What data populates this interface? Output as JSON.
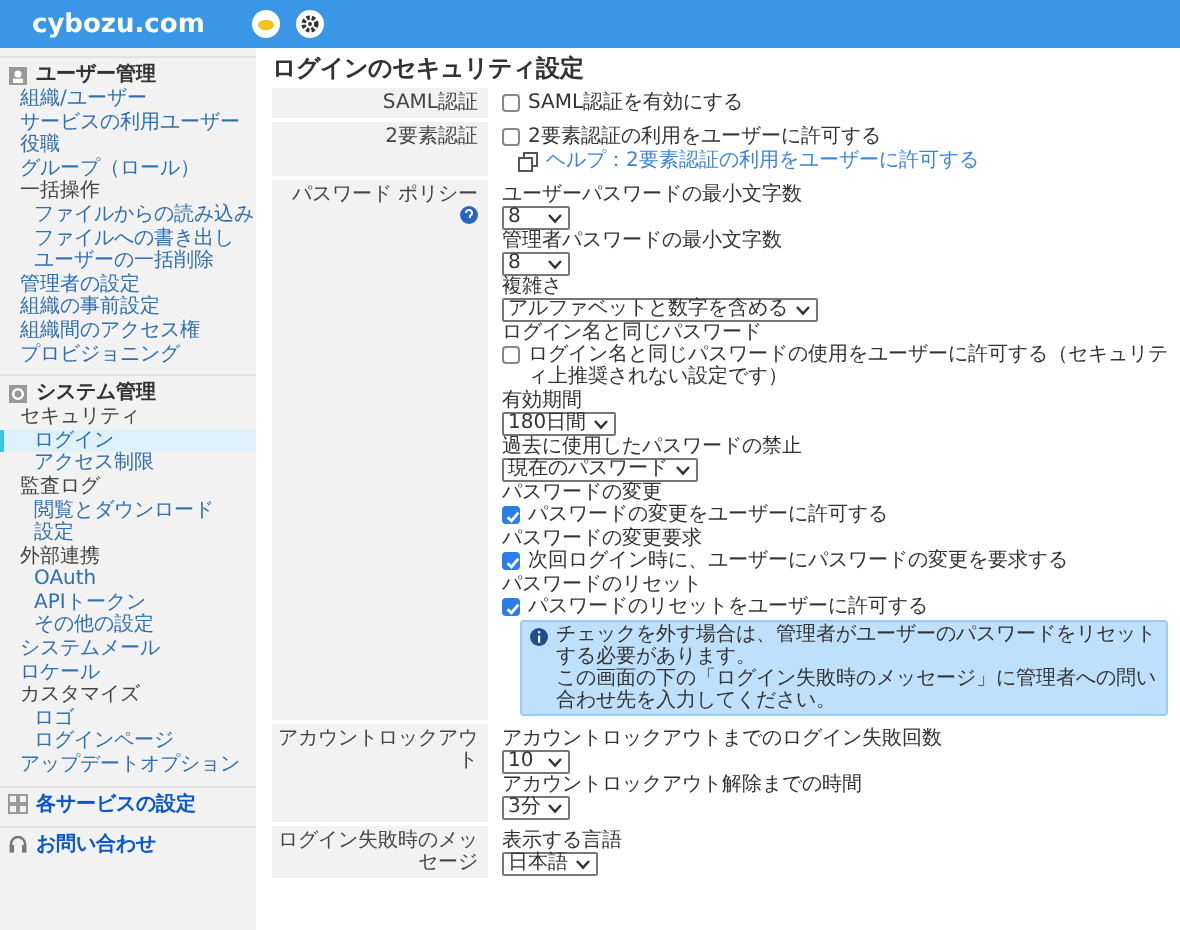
{
  "header": {
    "logo": "cybozu.com"
  },
  "sidebar": {
    "sections": [
      {
        "title": "ユーザー管理",
        "items": [
          {
            "label": "組織/ユーザー",
            "kind": "link",
            "selected": false
          },
          {
            "label": "サービスの利用ユーザー",
            "kind": "link",
            "selected": false
          },
          {
            "label": "役職",
            "kind": "link",
            "selected": false
          },
          {
            "label": "グループ（ロール）",
            "kind": "link",
            "selected": false
          },
          {
            "label": "一括操作",
            "kind": "group",
            "selected": false,
            "children": [
              {
                "label": "ファイルからの読み込み",
                "kind": "link",
                "selected": false
              },
              {
                "label": "ファイルへの書き出し",
                "kind": "link",
                "selected": false
              },
              {
                "label": "ユーザーの一括削除",
                "kind": "link",
                "selected": false
              }
            ]
          },
          {
            "label": "管理者の設定",
            "kind": "link",
            "selected": false
          },
          {
            "label": "組織の事前設定",
            "kind": "link",
            "selected": false
          },
          {
            "label": "組織間のアクセス権",
            "kind": "link",
            "selected": false
          },
          {
            "label": "プロビジョニング",
            "kind": "link",
            "selected": false
          }
        ]
      },
      {
        "title": "システム管理",
        "items": [
          {
            "label": "セキュリティ",
            "kind": "group",
            "selected": false,
            "children": [
              {
                "label": "ログイン",
                "kind": "link",
                "selected": true
              },
              {
                "label": "アクセス制限",
                "kind": "link",
                "selected": false
              }
            ]
          },
          {
            "label": "監査ログ",
            "kind": "group",
            "selected": false,
            "children": [
              {
                "label": "閲覧とダウンロード",
                "kind": "link",
                "selected": false
              },
              {
                "label": "設定",
                "kind": "link",
                "selected": false
              }
            ]
          },
          {
            "label": "外部連携",
            "kind": "group",
            "selected": false,
            "children": [
              {
                "label": "OAuth",
                "kind": "link",
                "selected": false
              },
              {
                "label": "APIトークン",
                "kind": "link",
                "selected": false
              },
              {
                "label": "その他の設定",
                "kind": "link",
                "selected": false
              }
            ]
          },
          {
            "label": "システムメール",
            "kind": "link",
            "selected": false
          },
          {
            "label": "ロケール",
            "kind": "link",
            "selected": false
          },
          {
            "label": "カスタマイズ",
            "kind": "group",
            "selected": false,
            "children": [
              {
                "label": "ロゴ",
                "kind": "link",
                "selected": false
              },
              {
                "label": "ログインページ",
                "kind": "link",
                "selected": false
              }
            ]
          },
          {
            "label": "アップデートオプション",
            "kind": "link",
            "selected": false
          }
        ]
      },
      {
        "title": "各サービスの設定"
      },
      {
        "title": "お問い合わせ"
      }
    ]
  },
  "main": {
    "title": "ログインのセキュリティ設定",
    "rows": [
      {
        "label": "SAML認証",
        "fields": [
          {
            "kind": "checkbox",
            "label": "SAML認証を有効にする",
            "checked": false
          }
        ]
      },
      {
        "label": "2要素認証",
        "fields": [
          {
            "kind": "checkbox",
            "label": "2要素認証の利用をユーザーに許可する",
            "checked": false
          },
          {
            "kind": "help_link",
            "label": "ヘルプ：2要素認証の利用をユーザーに許可する"
          }
        ]
      },
      {
        "label": "パスワード ポリシー",
        "help": true,
        "fields": [
          {
            "kind": "heading",
            "label": "ユーザーパスワードの最小文字数"
          },
          {
            "kind": "select",
            "value": "8"
          },
          {
            "kind": "heading",
            "label": "管理者パスワードの最小文字数"
          },
          {
            "kind": "select",
            "value": "8"
          },
          {
            "kind": "heading",
            "label": "複雑さ"
          },
          {
            "kind": "select",
            "value": "アルファベットと数字を含める"
          },
          {
            "kind": "heading",
            "label": "ログイン名と同じパスワード"
          },
          {
            "kind": "checkbox",
            "label": "ログイン名と同じパスワードの使用をユーザーに許可する（セキュリティ上推奨されない設定です）",
            "checked": false
          },
          {
            "kind": "heading",
            "label": "有効期間"
          },
          {
            "kind": "select",
            "value": "180日間"
          },
          {
            "kind": "heading",
            "label": "過去に使用したパスワードの禁止"
          },
          {
            "kind": "select",
            "value": "現在のパスワード"
          },
          {
            "kind": "heading",
            "label": "パスワードの変更"
          },
          {
            "kind": "checkbox",
            "label": "パスワードの変更をユーザーに許可する",
            "checked": true
          },
          {
            "kind": "heading",
            "label": "パスワードの変更要求"
          },
          {
            "kind": "checkbox",
            "label": "次回ログイン時に、ユーザーにパスワードの変更を要求する",
            "checked": true
          },
          {
            "kind": "heading",
            "label": "パスワードのリセット"
          },
          {
            "kind": "checkbox",
            "label": "パスワードのリセットをユーザーに許可する",
            "checked": true
          },
          {
            "kind": "info",
            "lines": [
              "チェックを外す場合は、管理者がユーザーのパスワードをリセットする必要があります。",
              "この画面の下の「ログイン失敗時のメッセージ」に管理者への問い合わせ先を入力してください。"
            ]
          }
        ]
      },
      {
        "label": "アカウントロックアウト",
        "fields": [
          {
            "kind": "heading",
            "label": "アカウントロックアウトまでのログイン失敗回数"
          },
          {
            "kind": "select",
            "value": "10"
          },
          {
            "kind": "heading",
            "label": "アカウントロックアウト解除までの時間"
          },
          {
            "kind": "select",
            "value": "3分"
          }
        ]
      },
      {
        "label": "ログイン失敗時のメッセージ",
        "fields": [
          {
            "kind": "heading",
            "label": "表示する言語"
          },
          {
            "kind": "select",
            "value": "日本語"
          }
        ]
      }
    ]
  }
}
